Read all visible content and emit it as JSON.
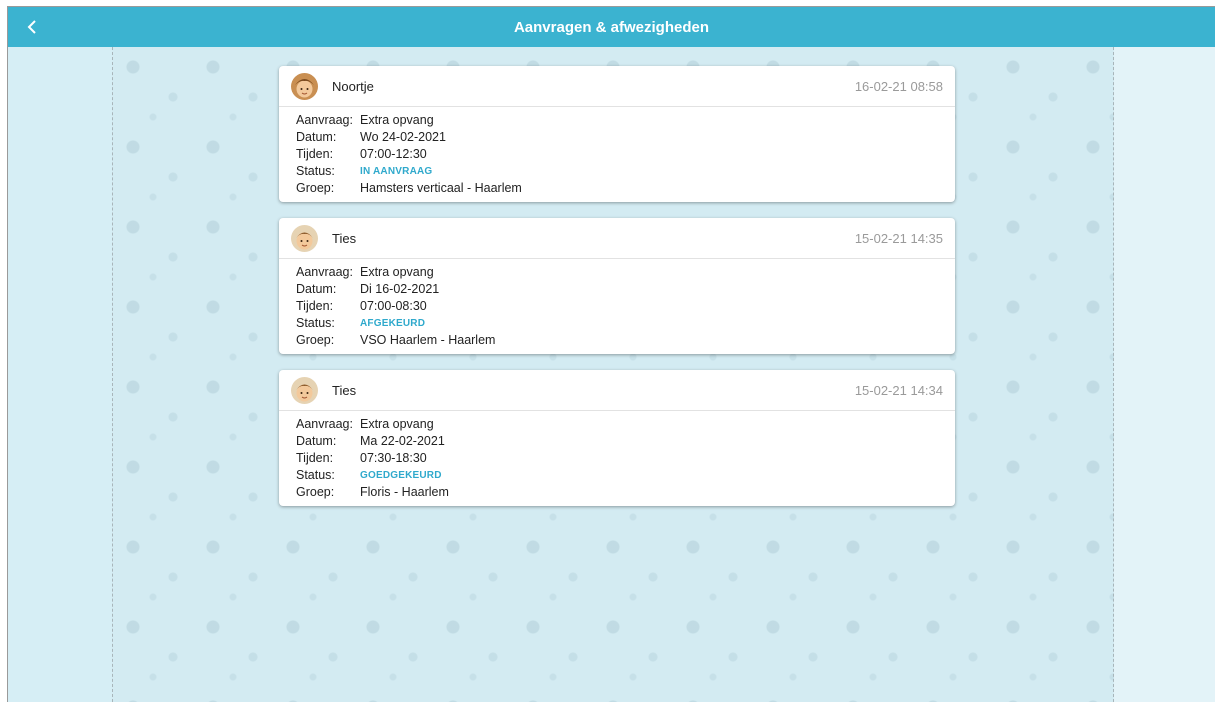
{
  "header": {
    "title": "Aanvragen & afwezigheden"
  },
  "labels": {
    "aanvraag": "Aanvraag:",
    "datum": "Datum:",
    "tijden": "Tijden:",
    "status": "Status:",
    "groep": "Groep:"
  },
  "requests": [
    {
      "name": "Noortje",
      "timestamp": "16-02-21 08:58",
      "aanvraag": "Extra opvang",
      "datum": "Wo 24-02-2021",
      "tijden": "07:00-12:30",
      "status": "IN AANVRAAG",
      "groep": "Hamsters verticaal - Haarlem"
    },
    {
      "name": "Ties",
      "timestamp": "15-02-21 14:35",
      "aanvraag": "Extra opvang",
      "datum": "Di 16-02-2021",
      "tijden": "07:00-08:30",
      "status": "AFGEKEURD",
      "groep": "VSO Haarlem - Haarlem"
    },
    {
      "name": "Ties",
      "timestamp": "15-02-21 14:34",
      "aanvraag": "Extra opvang",
      "datum": "Ma 22-02-2021",
      "tijden": "07:30-18:30",
      "status": "GOEDGEKEURD",
      "groep": "Floris - Haarlem"
    }
  ],
  "colors": {
    "header": "#3bb3d0",
    "status": "#2fa9cc",
    "background": "#d6eef5"
  },
  "icons": {
    "back": "chevron-left-icon",
    "avatar": "child-avatar-icon"
  }
}
